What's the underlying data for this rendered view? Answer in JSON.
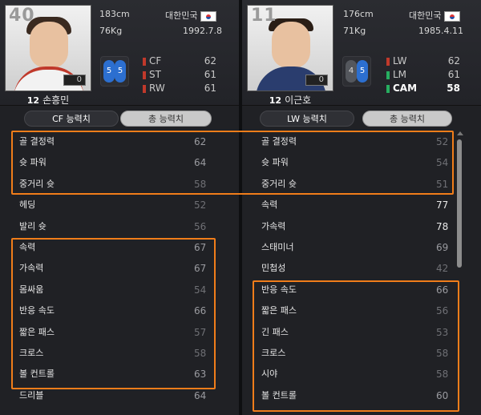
{
  "colors": {
    "accent_highlight": "#f07d1a",
    "foot_blue": "#2c6fd0",
    "pos_red": "#c0392b",
    "pos_green": "#27ae60"
  },
  "left_player": {
    "jersey_number": "40",
    "name": "손흥민",
    "level": "12",
    "height": "183cm",
    "weight": "76Kg",
    "country": "대한민국",
    "birth": "1992.7.8",
    "card_count": "0",
    "weak_foot": {
      "left": "5",
      "right": "5"
    },
    "positions": [
      {
        "name": "CF",
        "value": "62",
        "color": "#c0392b"
      },
      {
        "name": "ST",
        "value": "61",
        "color": "#c0392b"
      },
      {
        "name": "RW",
        "value": "61",
        "color": "#c0392b"
      }
    ],
    "tab_active": "CF 능력치",
    "tab_inactive": "총 능력치",
    "stats": [
      {
        "name": "골 결정력",
        "value": "62",
        "tone": "mid"
      },
      {
        "name": "슛 파워",
        "value": "64",
        "tone": "mid"
      },
      {
        "name": "중거리 슛",
        "value": "58",
        "tone": "dim"
      },
      {
        "name": "헤딩",
        "value": "52",
        "tone": "dim"
      },
      {
        "name": "발리 슛",
        "value": "56",
        "tone": "dim"
      },
      {
        "name": "속력",
        "value": "67",
        "tone": "mid"
      },
      {
        "name": "가속력",
        "value": "67",
        "tone": "mid"
      },
      {
        "name": "몸싸움",
        "value": "54",
        "tone": "dim"
      },
      {
        "name": "반응 속도",
        "value": "66",
        "tone": "mid"
      },
      {
        "name": "짧은 패스",
        "value": "57",
        "tone": "dim"
      },
      {
        "name": "크로스",
        "value": "58",
        "tone": "dim"
      },
      {
        "name": "볼 컨트롤",
        "value": "63",
        "tone": "mid"
      },
      {
        "name": "드리블",
        "value": "64",
        "tone": "mid"
      }
    ]
  },
  "right_player": {
    "jersey_number": "11",
    "name": "이근호",
    "level": "12",
    "height": "176cm",
    "weight": "71Kg",
    "country": "대한민국",
    "birth": "1985.4.11",
    "card_count": "0",
    "weak_foot": {
      "left": "4",
      "right": "5"
    },
    "positions": [
      {
        "name": "LW",
        "value": "62",
        "color": "#c0392b"
      },
      {
        "name": "LM",
        "value": "61",
        "color": "#27ae60"
      },
      {
        "name": "CAM",
        "value": "58",
        "color": "#27ae60"
      }
    ],
    "tab_active": "LW 능력치",
    "tab_inactive": "총 능력치",
    "stats": [
      {
        "name": "골 결정력",
        "value": "52",
        "tone": "dim"
      },
      {
        "name": "슛 파워",
        "value": "54",
        "tone": "dim"
      },
      {
        "name": "중거리 슛",
        "value": "51",
        "tone": "dim"
      },
      {
        "name": "속력",
        "value": "77",
        "tone": "hi"
      },
      {
        "name": "가속력",
        "value": "78",
        "tone": "hi"
      },
      {
        "name": "스태미너",
        "value": "69",
        "tone": "mid"
      },
      {
        "name": "민첩성",
        "value": "42",
        "tone": "dim"
      },
      {
        "name": "반응 속도",
        "value": "66",
        "tone": "mid"
      },
      {
        "name": "짧은 패스",
        "value": "56",
        "tone": "dim"
      },
      {
        "name": "긴 패스",
        "value": "53",
        "tone": "dim"
      },
      {
        "name": "크로스",
        "value": "58",
        "tone": "dim"
      },
      {
        "name": "시야",
        "value": "58",
        "tone": "dim"
      },
      {
        "name": "볼 컨트롤",
        "value": "60",
        "tone": "mid"
      }
    ]
  }
}
